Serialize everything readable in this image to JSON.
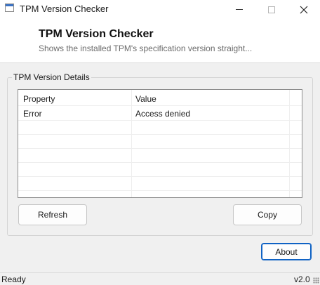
{
  "window": {
    "title": "TPM Version Checker"
  },
  "header": {
    "title": "TPM Version Checker",
    "subtitle": "Shows the installed TPM's specification version straight..."
  },
  "details": {
    "group_label": "TPM Version Details",
    "columns": [
      "Property",
      "Value"
    ],
    "rows": [
      {
        "property": "Error",
        "value": "Access denied"
      }
    ]
  },
  "buttons": {
    "refresh": "Refresh",
    "copy": "Copy",
    "about": "About"
  },
  "status": {
    "text": "Ready",
    "version": "v2.0"
  },
  "icons": {
    "app": "app-window-icon",
    "minimize": "minimize-icon",
    "maximize": "maximize-icon",
    "close": "close-icon",
    "grip": "resize-grip-icon"
  }
}
